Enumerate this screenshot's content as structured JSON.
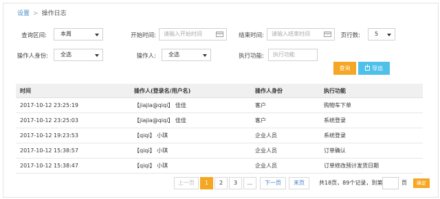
{
  "breadcrumb": {
    "root": "设置",
    "current": "操作日志"
  },
  "filters": {
    "range_label": "查询区间:",
    "range_value": "本周",
    "start_label": "开始时间:",
    "start_placeholder": "请输入开始时间",
    "end_label": "结束时间:",
    "end_placeholder": "请输入结束时间",
    "page_size_label": "页行数:",
    "page_size_value": "5",
    "identity_label": "操作人身份:",
    "identity_value": "全选",
    "operator_label": "操作人:",
    "operator_value": "全选",
    "function_label": "执行功能:",
    "function_placeholder": "执行功能"
  },
  "actions": {
    "query_label": "查询",
    "export_label": "导出"
  },
  "table": {
    "headers": [
      "时间",
      "操作人(登录名/用户名)",
      "操作人身份",
      "执行功能"
    ],
    "rows": [
      [
        "2017-10-12 23:25:19",
        "【jiajia@qiqi】 佳佳",
        "客户",
        "购物车下单"
      ],
      [
        "2017-10-12 23:25:03",
        "【jiajia@qiqi】 佳佳",
        "客户",
        "系统登录"
      ],
      [
        "2017-10-12 19:23:53",
        "【qiqi】 小琪",
        "企业人员",
        "系统登录"
      ],
      [
        "2017-10-12 15:38:57",
        "【qiqi】 小琪",
        "企业人员",
        "订单确认"
      ],
      [
        "2017-10-12 15:38:47",
        "【qiqi】 小琪",
        "企业人员",
        "订单修改预计发货日期"
      ]
    ]
  },
  "pagination": {
    "prev_label": "上一页",
    "pages": [
      "1",
      "2",
      "3",
      "..."
    ],
    "current_page": "1",
    "next_label": "下一页",
    "last_label": "末页",
    "summary": "共18页，89个记录，到第",
    "page_suffix": "页",
    "confirm_label": "确定"
  },
  "colors": {
    "accent": "#f5a623",
    "export": "#4fc1e9",
    "link": "#4a90c6"
  }
}
